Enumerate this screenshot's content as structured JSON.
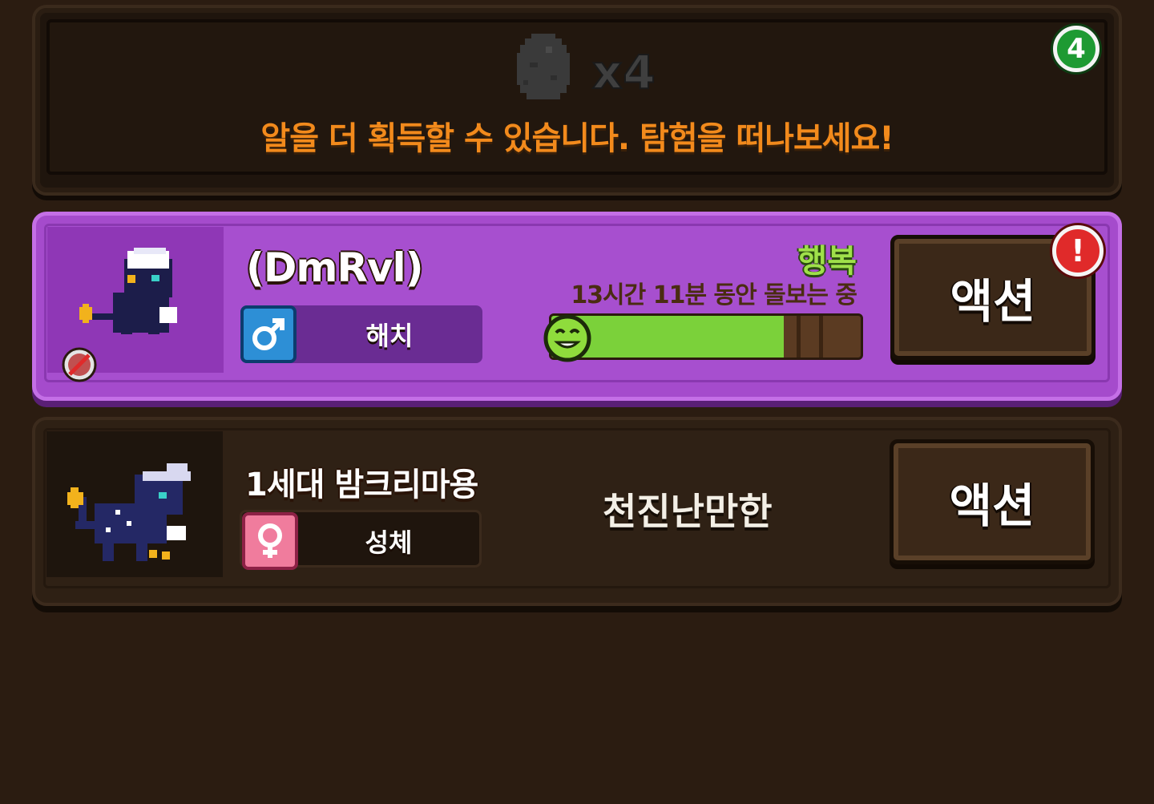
{
  "egg_panel": {
    "egg_icon": "egg-icon",
    "count": "x4",
    "message": "알을 더 획득할 수 있습니다. 탐험을 떠나보세요!",
    "badge": "4"
  },
  "pets": [
    {
      "name": "(DmRvl)",
      "gender": "male-icon",
      "stage": "해치",
      "mood": "행복",
      "care_status": "13시간 11분 동안 돌보는 중",
      "happiness_fraction": 0.75,
      "action_label": "액션",
      "alert_badge": "!",
      "status_icon": "no-breed-icon",
      "selected": true,
      "colors": {
        "card": "#a54bcc",
        "mood": "#9fe04a",
        "bar_fill": "#7bd13a"
      }
    },
    {
      "name": "1세대 밤크리마용",
      "gender": "female-icon",
      "stage": "성체",
      "personality": "천진난만한",
      "action_label": "액션",
      "selected": false
    }
  ],
  "colors": {
    "background": "#2b1c11",
    "message": "#f28a1c",
    "badge_green": "#1e9a33",
    "badge_red": "#e02a2a"
  }
}
